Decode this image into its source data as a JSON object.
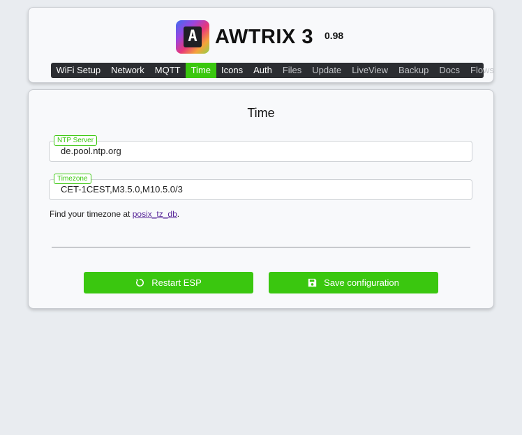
{
  "header": {
    "logo_letter": "A",
    "title": "AWTRIX 3",
    "version": "0.98"
  },
  "nav": {
    "items": [
      {
        "label": "WiFi Setup",
        "state": "normal"
      },
      {
        "label": "Network",
        "state": "normal"
      },
      {
        "label": "MQTT",
        "state": "normal"
      },
      {
        "label": "Time",
        "state": "active"
      },
      {
        "label": "Icons",
        "state": "normal"
      },
      {
        "label": "Auth",
        "state": "normal"
      },
      {
        "label": "Files",
        "state": "dim"
      },
      {
        "label": "Update",
        "state": "dim"
      },
      {
        "label": "LiveView",
        "state": "dim"
      },
      {
        "label": "Backup",
        "state": "dim"
      },
      {
        "label": "Docs",
        "state": "dim"
      },
      {
        "label": "Flows",
        "state": "dim"
      }
    ]
  },
  "content": {
    "title": "Time",
    "ntp": {
      "label": "NTP Server",
      "value": "de.pool.ntp.org"
    },
    "timezone": {
      "label": "Timezone",
      "value": "CET-1CEST,M3.5.0,M10.5.0/3"
    },
    "help_prefix": "Find your timezone at ",
    "help_link": "posix_tz_db",
    "help_suffix": ".",
    "restart_label": "Restart ESP",
    "save_label": "Save configuration"
  },
  "colors": {
    "accent": "#3ac70f",
    "nav_bg": "#2b2d31",
    "link": "#5a2a9a"
  },
  "icons": {
    "restart": "restart-icon",
    "save": "floppy-disk-icon"
  }
}
